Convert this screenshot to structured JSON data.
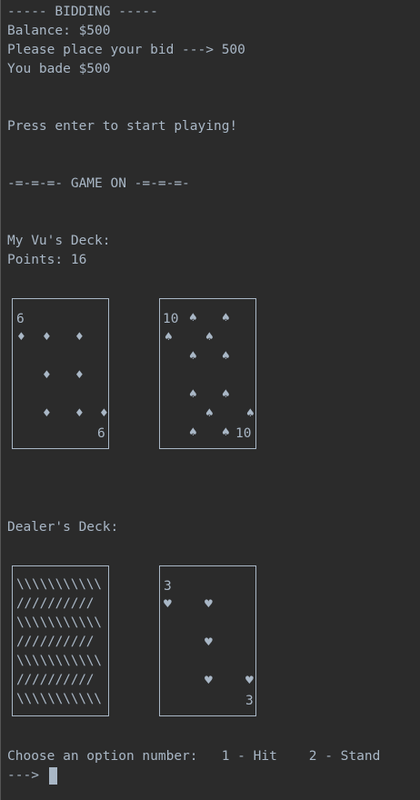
{
  "terminal": {
    "lines": [
      "----- BIDDING -----",
      "Balance: $500",
      "Please place your bid ---> 500",
      "You bade $500",
      "Press enter to start playing!",
      "-=-=-=- GAME ON -=-=-=-",
      "My Vu's Deck:",
      "Points: 16",
      "Dealer's Deck:",
      "Choose an option number:   1 - Hit    2 - Stand",
      "--->"
    ]
  },
  "player_cards": [
    {
      "rank": "6",
      "suit": "diamonds",
      "suit_glyph": "♦"
    },
    {
      "rank": "10",
      "suit": "spades",
      "suit_glyph": "♠"
    }
  ],
  "dealer_cards": [
    {
      "face_down": true,
      "back_pattern": [
        "\\\\\\\\\\\\\\\\\\\\\\",
        "//////////",
        "\\\\\\\\\\\\\\\\\\\\\\",
        "//////////",
        "\\\\\\\\\\\\\\\\\\\\\\",
        "//////////",
        "\\\\\\\\\\\\\\\\\\\\\\"
      ]
    },
    {
      "rank": "3",
      "suit": "hearts",
      "suit_glyph": "♥"
    }
  ],
  "colors": {
    "background": "#2b2b2b",
    "text": "#a9b7c6",
    "cursor": "#a9b7c6"
  }
}
